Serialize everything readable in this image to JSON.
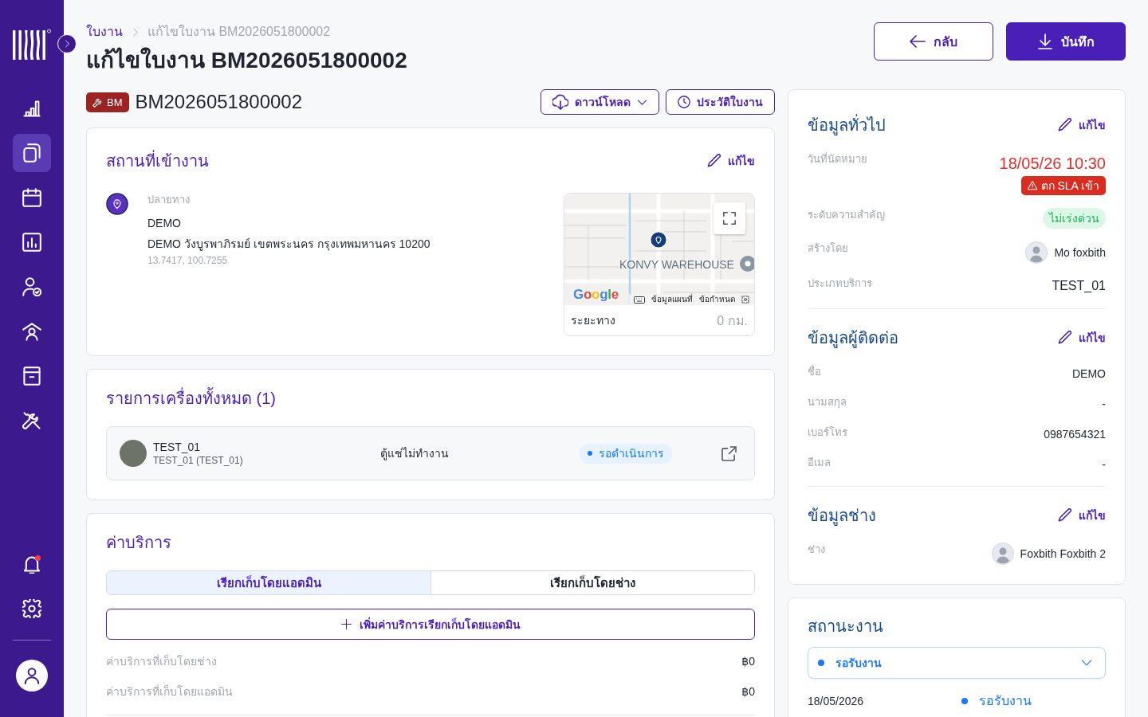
{
  "sidebar": {
    "items": [
      {
        "selected": false
      },
      {
        "selected": true
      },
      {
        "selected": false
      },
      {
        "selected": false
      },
      {
        "selected": false
      },
      {
        "selected": false
      },
      {
        "selected": false
      },
      {
        "selected": false
      }
    ],
    "notifications": {
      "unread": true
    }
  },
  "breadcrumb": [
    "ใบงาน",
    "แก้ไขใบงาน BM2026051800002"
  ],
  "page_title": "แก้ไขใบงาน BM2026051800002",
  "header_buttons": [
    {
      "label": "กลับ",
      "kind": "back"
    },
    {
      "label": "บันทึก",
      "kind": "save"
    }
  ],
  "job": {
    "type_badge": "BM",
    "number": "BM2026051800002",
    "actions": [
      {
        "label": "ดาวน์โหลด",
        "kind": "download"
      },
      {
        "label": "ประวัติใบงาน",
        "kind": "history"
      }
    ]
  },
  "location": {
    "title": "สถานที่เข้างาน",
    "edit": "แก้ไข",
    "label": "ปลายทาง",
    "name": "DEMO",
    "address": "DEMO วังบูรพาภิรมย์ เขตพระนคร กรุงเทพมหานคร 10200",
    "coordinates": "13.7417, 100.7255",
    "map": {
      "place_label": "KONVY WAREHOUSE",
      "logo": "Google",
      "links": [
        "ข้อมูลแผนที่",
        "ข้อกำหนด"
      ]
    },
    "distance": {
      "label": "ระยะทาง",
      "value": "0 กม."
    }
  },
  "devices": {
    "title": "รายการเครื่องทั้งหมด (1)",
    "items": [
      {
        "name": "TEST_01",
        "detail": "TEST_01 (TEST_01)",
        "problem": "ตู้แช่ไม่ทำงาน",
        "status": "รอดำเนินการ",
        "color": "#1677ff"
      }
    ]
  },
  "charges": {
    "title": "ค่าบริการ",
    "tabs": [
      {
        "label": "เรียกเก็บโดยแอดมิน",
        "selected": true
      },
      {
        "label": "เรียกเก็บโดยช่าง",
        "selected": false
      }
    ],
    "add_button": "เพิ่มค่าบริการเรียกเก็บโดยแอดมิน",
    "rows": [
      {
        "label": "ค่าบริการที่เก็บโดยช่าง",
        "value": "฿0"
      },
      {
        "label": "ค่าบริการที่เก็บโดยแอดมิน",
        "value": "฿0"
      }
    ]
  },
  "info_sections": [
    {
      "title": "ข้อมูลทั่วไป",
      "edit": "แก้ไข",
      "rows": [
        {
          "label": "วันที่นัดหมาย",
          "kind": "datetime",
          "value": "18/05/26 10:30",
          "badge": "ตก SLA เข้า"
        },
        {
          "label": "ระดับความสำคัญ",
          "kind": "pill",
          "value": "ไม่เร่งด่วน"
        },
        {
          "label": "สร้างโดย",
          "kind": "person",
          "value": "Mo foxbith"
        },
        {
          "label": "ประเภทบริการ",
          "kind": "large",
          "value": "TEST_01"
        }
      ]
    },
    {
      "title": "ข้อมูลผู้ติดต่อ",
      "edit": "แก้ไข",
      "rows": [
        {
          "label": "ชื่อ",
          "kind": "text",
          "value": "DEMO"
        },
        {
          "label": "นามสกุล",
          "kind": "text",
          "value": "-"
        },
        {
          "label": "เบอร์โทร",
          "kind": "text",
          "value": "0987654321"
        },
        {
          "label": "อีเมล",
          "kind": "text",
          "value": "-"
        }
      ]
    },
    {
      "title": "ข้อมูลช่าง",
      "edit": "แก้ไข",
      "rows": [
        {
          "label": "ช่าง",
          "kind": "person",
          "value": "Foxbith Foxbith 2"
        }
      ]
    }
  ],
  "job_status": {
    "title": "สถานะงาน",
    "select": {
      "value": "รอรับงาน",
      "color": "#1677ff"
    },
    "history": [
      {
        "date": "18/05/2026",
        "status": "รอรับงาน",
        "color": "#1677ff"
      }
    ]
  }
}
